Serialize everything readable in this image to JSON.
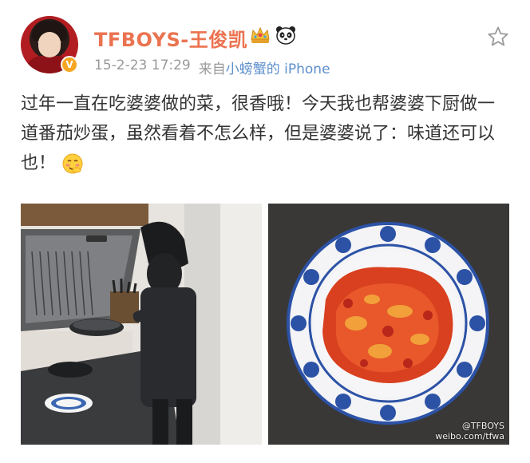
{
  "post": {
    "username": "TFBOYS-王俊凯",
    "timestamp": "15-2-23 17:29",
    "source_prefix": "来自",
    "source_client": "小螃蟹的 iPhone",
    "text": "过年一直在吃婆婆做的菜，很香哦！今天我也帮婆婆下厨做一道番茄炒蛋，虽然看着不怎么样，但是婆婆说了：味道还可以也！",
    "verified_badge": "V",
    "watermark_line1": "@TFBOYS",
    "watermark_line2": "weibo.com/tfwa"
  },
  "icons": {
    "crown": "crown-icon",
    "panda": "panda-icon",
    "favorite": "star-icon",
    "emoji": "blush-emoji-icon"
  },
  "colors": {
    "username": "#eb7350",
    "client_link": "#5d8fcc",
    "meta": "#999999"
  }
}
